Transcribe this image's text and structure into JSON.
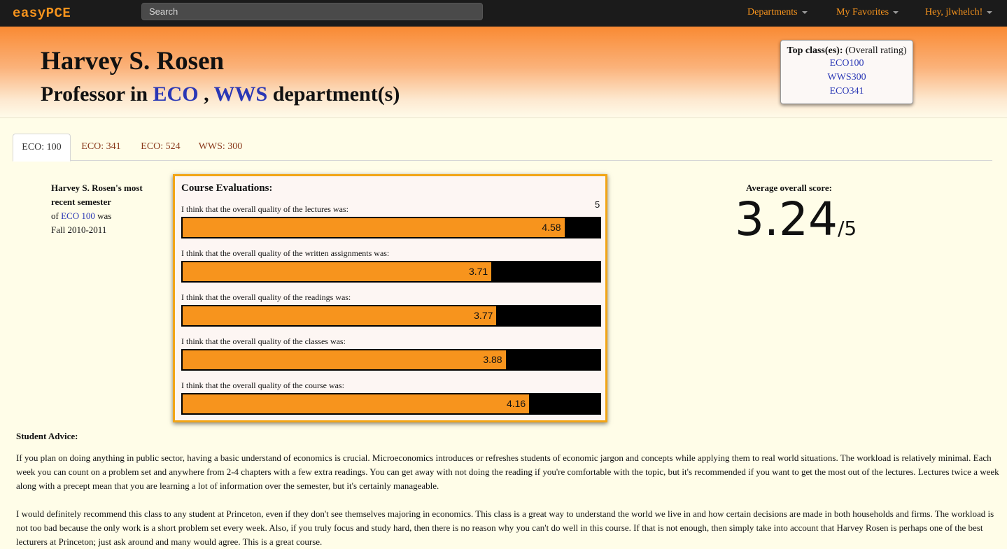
{
  "nav": {
    "brand": "easyPCE",
    "search_placeholder": "Search",
    "departments": "Departments",
    "favorites": "My Favorites",
    "user": "Hey, jlwhelch!"
  },
  "header": {
    "name": "Harvey S. Rosen",
    "dept_prefix": "Professor in",
    "dept1": "ECO",
    "dept_sep": ",",
    "dept2": "WWS",
    "dept_suffix": "department(s)"
  },
  "top_classes": {
    "title": "Top class(es):",
    "subtitle": "(Overall rating)",
    "items": [
      "ECO100",
      "WWS300",
      "ECO341"
    ]
  },
  "tabs": [
    "ECO: 100",
    "ECO: 341",
    "ECO: 524",
    "WWS: 300"
  ],
  "recent": {
    "line1": "Harvey S. Rosen's most recent semester",
    "of": "of",
    "course": "ECO 100",
    "was": "was",
    "term": "Fall 2010-2011"
  },
  "evaluations": {
    "title": "Course Evaluations:",
    "max": 5,
    "items": [
      {
        "question": "I think that the overall quality of the lectures was:",
        "score": 4.58
      },
      {
        "question": "I think that the overall quality of the written assignments was:",
        "score": 3.71
      },
      {
        "question": "I think that the overall quality of the readings was:",
        "score": 3.77
      },
      {
        "question": "I think that the overall quality of the classes was:",
        "score": 3.88
      },
      {
        "question": "I think that the overall quality of the course was:",
        "score": 4.16
      }
    ]
  },
  "average": {
    "label": "Average overall score:",
    "score": "3.24",
    "out_of": "/5"
  },
  "advice": {
    "title": "Student Advice:",
    "paragraphs": [
      "If you plan on doing anything in public sector, having a basic understand of economics is crucial. Microeconomics introduces or refreshes students of economic jargon and concepts while applying them to real world situations. The workload is relatively minimal. Each week you can count on a problem set and anywhere from 2-4 chapters with a few extra readings. You can get away with not doing the reading if you're comfortable with the topic, but it's recommended if you want to get the most out of the lectures. Lectures twice a week along with a precept mean that you are learning a lot of information over the semester, but it's certainly manageable.",
      "I would definitely recommend this class to any student at Princeton, even if they don't see themselves majoring in economics. This class is a great way to understand the world we live in and how certain decisions are made in both households and firms. The workload is not too bad because the only work is a short problem set every week. Also, if you truly focus and study hard, then there is no reason why you can't do well in this course. If that is not enough, then simply take into account that Harvey Rosen is perhaps one of the best lecturers at Princeton; just ask around and many would agree. This is a great course."
    ]
  }
}
